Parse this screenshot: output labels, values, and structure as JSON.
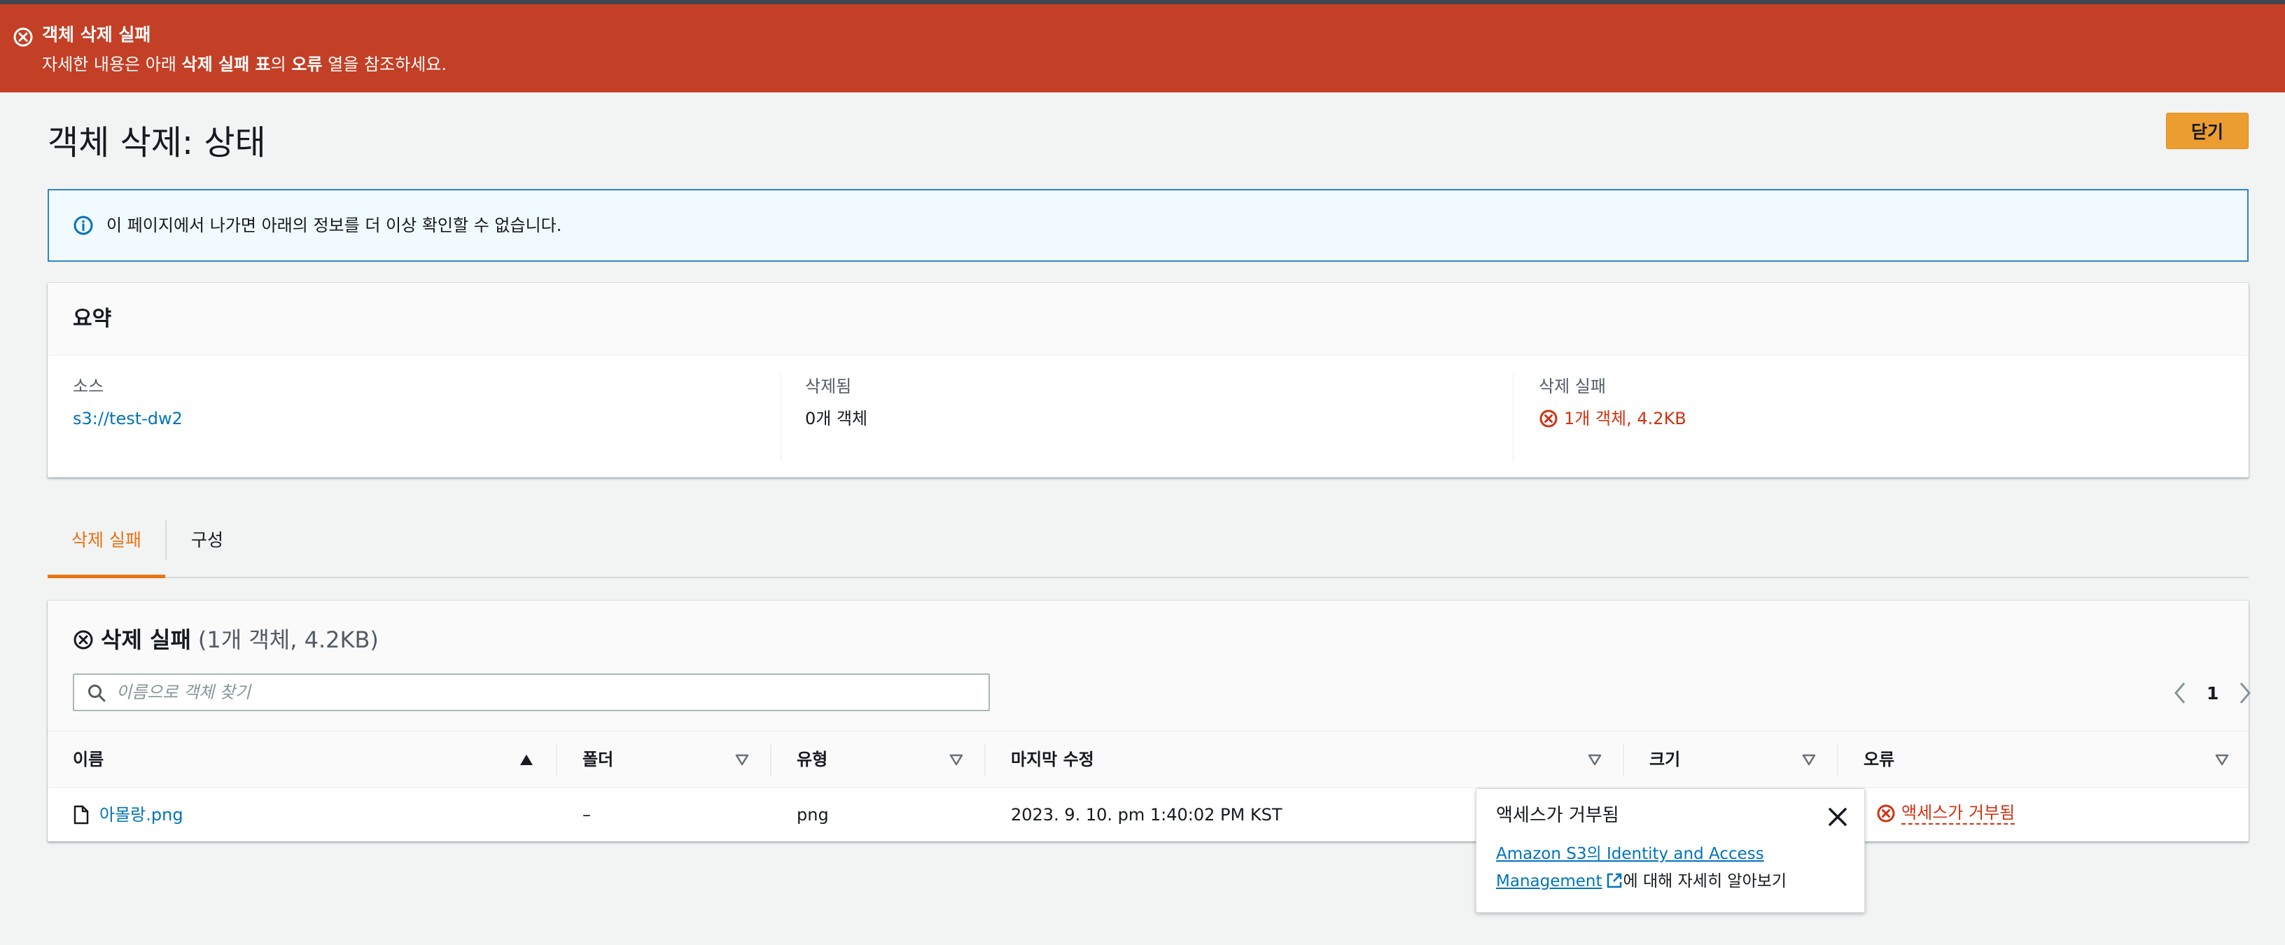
{
  "flash": {
    "title": "객체 삭제 실패",
    "desc_1": "자세한 내용은 아래 ",
    "desc_2": "삭제 실패 표",
    "desc_3": "의 ",
    "desc_4": "오류",
    "desc_5": " 열을 참조하세요."
  },
  "page": {
    "title": "객체 삭제: 상태",
    "close_label": "닫기"
  },
  "info": {
    "text": "이 페이지에서 나가면 아래의 정보를 더 이상 확인할 수 없습니다."
  },
  "summary": {
    "title": "요약",
    "source_label": "소스",
    "source_value": "s3://test-dw2",
    "deleted_label": "삭제됨",
    "deleted_value": "0개 객체",
    "failed_label": "삭제 실패",
    "failed_value": "1개 객체, 4.2KB"
  },
  "tabs": [
    {
      "label": "삭제 실패"
    },
    {
      "label": "구성"
    }
  ],
  "table": {
    "title": "삭제 실패",
    "count": "(1개 객체, 4.2KB)",
    "search_placeholder": "이름으로 객체 찾기",
    "page": "1",
    "columns": [
      {
        "label": "이름"
      },
      {
        "label": "폴더"
      },
      {
        "label": "유형"
      },
      {
        "label": "마지막 수정"
      },
      {
        "label": "크기"
      },
      {
        "label": "오류"
      }
    ],
    "rows": [
      {
        "name": "아몰랑.png",
        "folder": "–",
        "type": "png",
        "modified": "2023. 9. 10. pm 1:40:02 PM KST",
        "size": "",
        "error": "액세스가 거부됨"
      }
    ]
  },
  "popover": {
    "title": "액세스가 거부됨",
    "link_1": "Amazon S3의 Identity and Access",
    "link_2": "Management",
    "suffix": "에 대해 자세히 알아보기"
  },
  "colors": {
    "flash_error": "#c33f25",
    "accent_orange": "#ec7211",
    "primary_button": "#ec9d30",
    "link": "#0073bb",
    "error_text": "#d13212",
    "info_border": "#3184c2"
  },
  "icons": {
    "flash": "error-circle-icon",
    "info": "info-circle-icon",
    "file": "file-icon",
    "search": "search-icon",
    "close": "close-icon",
    "external": "external-link-icon"
  }
}
